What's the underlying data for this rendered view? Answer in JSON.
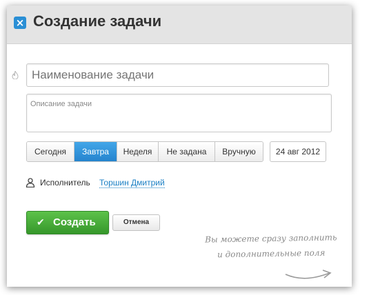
{
  "dialog": {
    "close_icon": "×",
    "title": "Создание задачи"
  },
  "form": {
    "name_placeholder": "Наименование задачи",
    "description_placeholder": "Описание задачи",
    "deadline_options": [
      "Сегодня",
      "Завтра",
      "Неделя",
      "Не задана",
      "Вручную"
    ],
    "deadline_selected": "Завтра",
    "date_value": "24 авг 2012",
    "assignee_label": "Исполнитель",
    "assignee_name": "Торшин Дмитрий"
  },
  "actions": {
    "create_label": "Создать",
    "cancel_label": "Отмена"
  },
  "hint": {
    "line1": "Вы можете сразу заполнить",
    "line2": "и дополнительные поля"
  },
  "colors": {
    "accent_blue": "#2a8fd5",
    "create_green": "#36972b",
    "link": "#1a7fc4"
  },
  "icons": [
    "close-icon",
    "flame-icon",
    "person-icon",
    "check-icon",
    "arrow-icon"
  ]
}
